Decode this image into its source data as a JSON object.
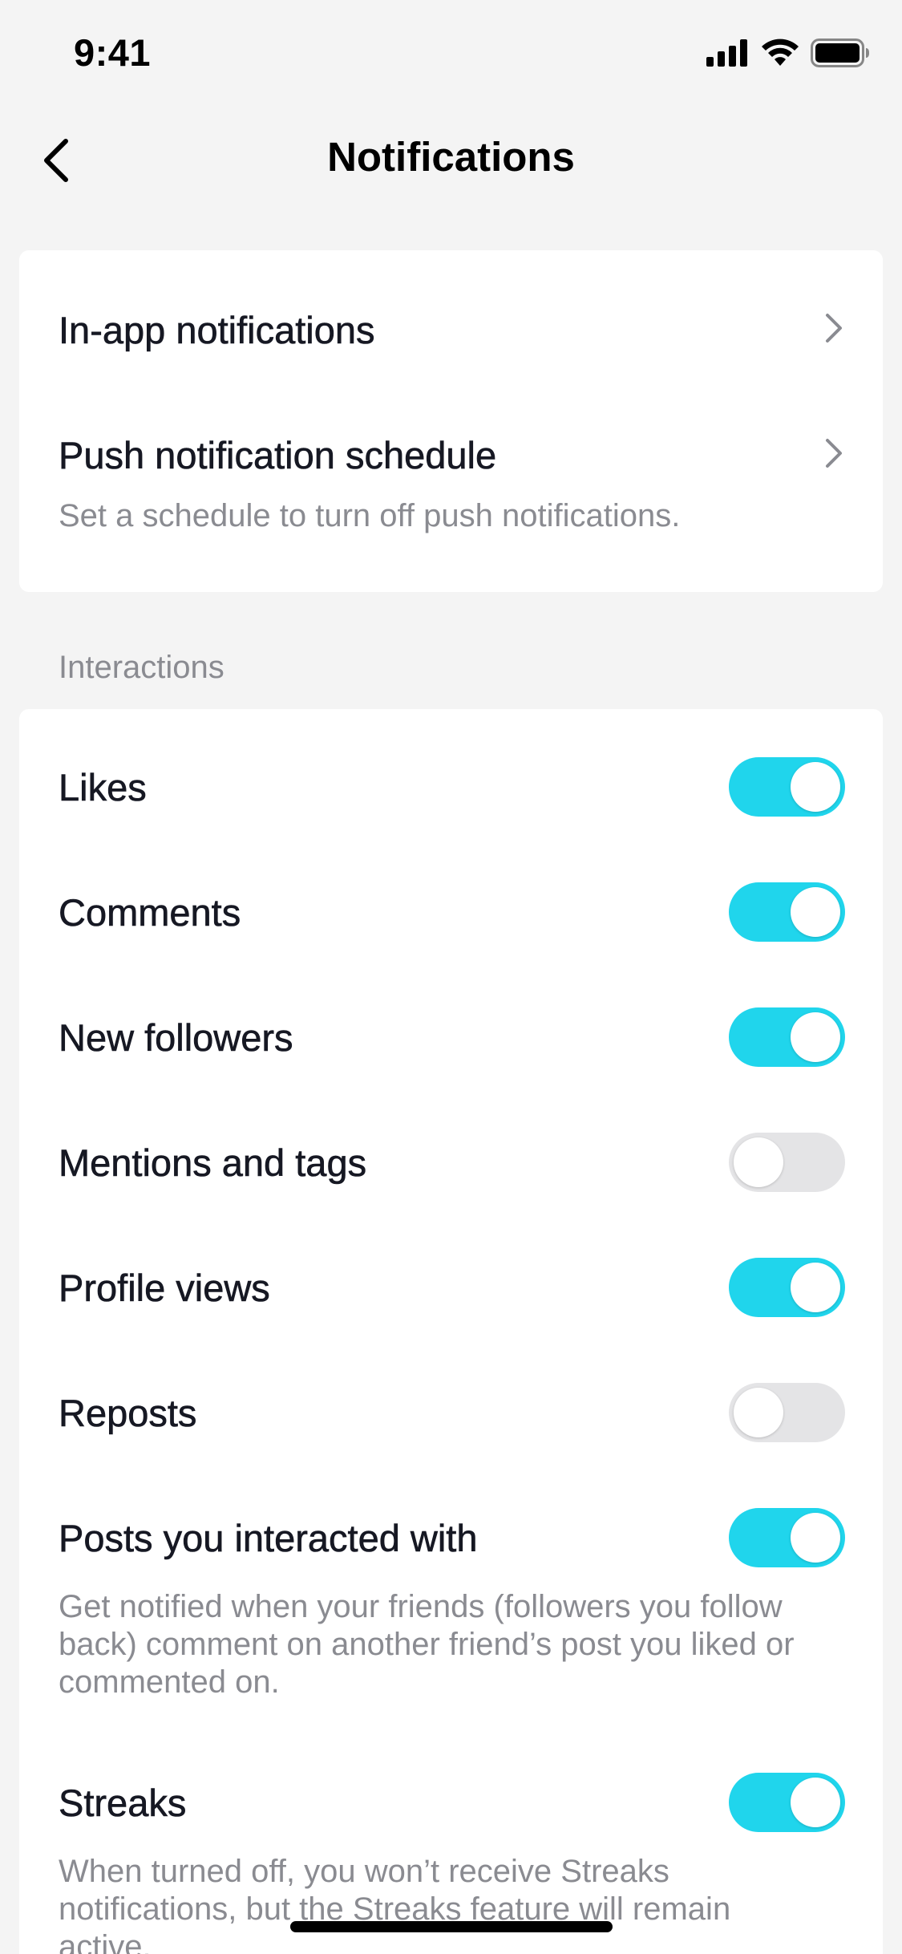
{
  "status_bar": {
    "time": "9:41",
    "icons": [
      "signal-icon",
      "wifi-icon",
      "battery-icon"
    ]
  },
  "nav": {
    "back_icon": "chevron-left-icon",
    "title": "Notifications"
  },
  "general": {
    "in_app": {
      "label": "In-app notifications"
    },
    "push_schedule": {
      "label": "Push notification schedule",
      "description": "Set a schedule to turn off push notifications."
    }
  },
  "interactions": {
    "header": "Interactions",
    "items": [
      {
        "label": "Likes",
        "enabled": true
      },
      {
        "label": "Comments",
        "enabled": true
      },
      {
        "label": "New followers",
        "enabled": true
      },
      {
        "label": "Mentions and tags",
        "enabled": false
      },
      {
        "label": "Profile views",
        "enabled": true
      },
      {
        "label": "Reposts",
        "enabled": false
      },
      {
        "label": "Posts you interacted with",
        "enabled": true,
        "description": "Get notified when your friends (followers you follow back) comment on another friend’s post you liked or commented on."
      },
      {
        "label": "Streaks",
        "enabled": true,
        "description": "When turned off, you won’t receive Streaks notifications, but the Streaks feature will remain active."
      }
    ]
  },
  "colors": {
    "toggle_on": "#20d5ec",
    "toggle_off": "#e4e4e6",
    "background": "#f4f4f4",
    "card": "#ffffff",
    "text_primary": "#161823",
    "text_secondary": "#8a8b91"
  }
}
